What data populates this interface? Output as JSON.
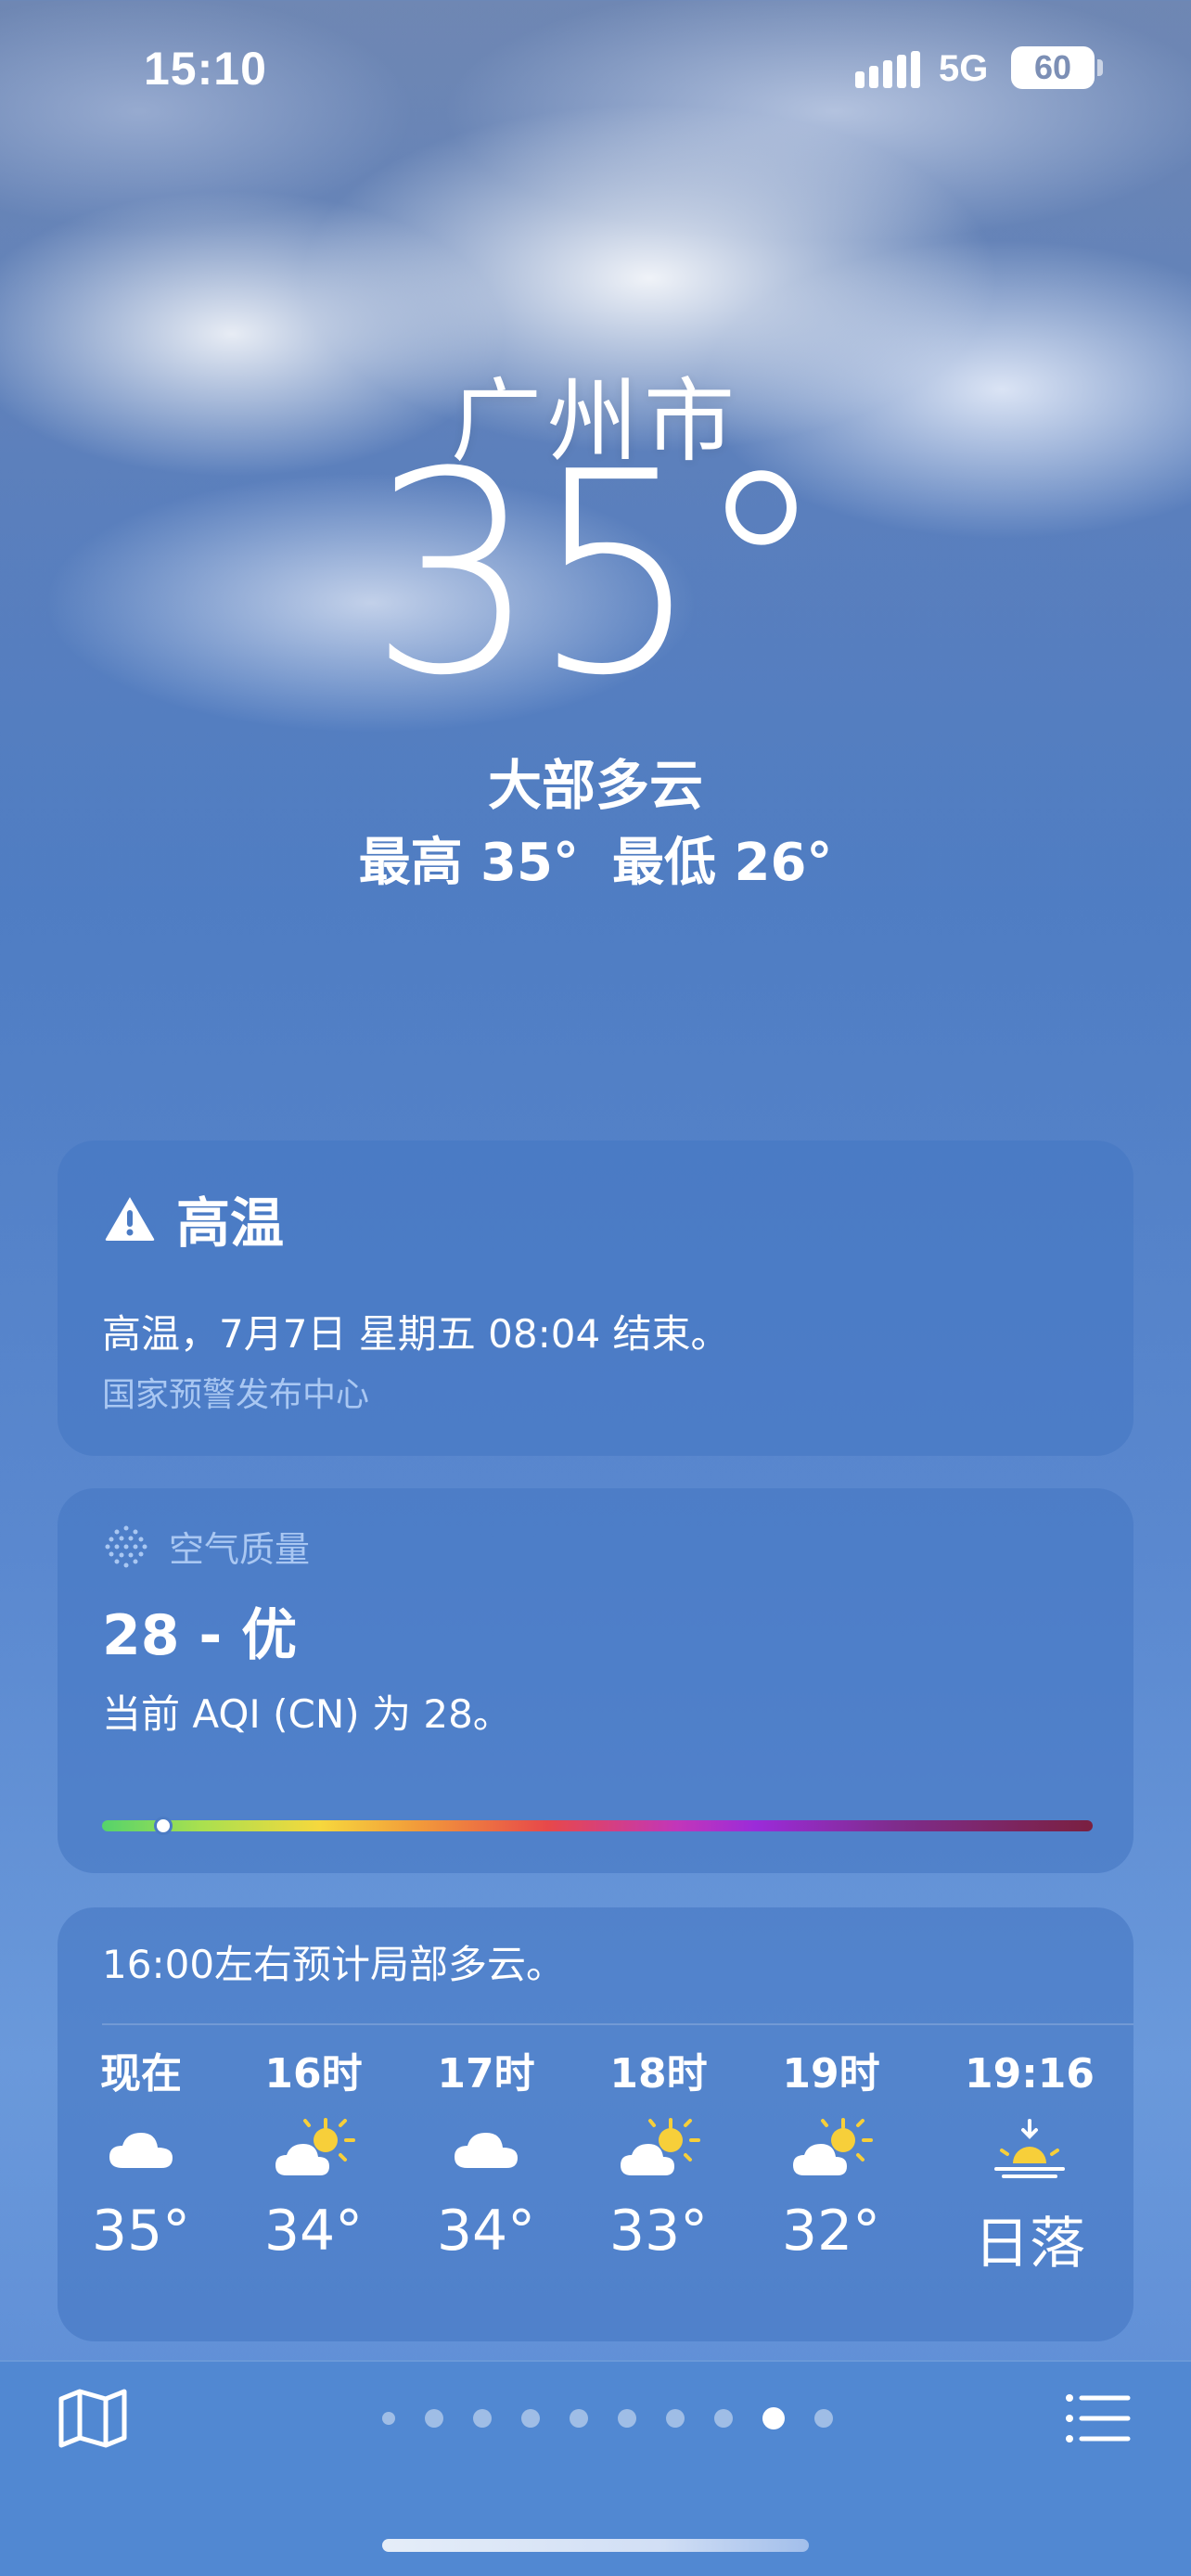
{
  "status_bar": {
    "time": "15:10",
    "network": "5G",
    "battery": "60"
  },
  "location": {
    "city": "广州市",
    "temperature": "35°",
    "condition": "大部多云",
    "high": "最高 35°",
    "low": "最低 26°"
  },
  "alert": {
    "icon": "warning-icon",
    "title": "高温",
    "description": "高温，7月7日 星期五 08:04 结束。",
    "source": "国家预警发布中心"
  },
  "air_quality": {
    "icon": "aqi-dots-icon",
    "header": "空气质量",
    "value": "28 - 优",
    "description": "当前 AQI (CN) 为 28。",
    "aqi_numeric": 28
  },
  "hourly": {
    "summary": "16:00左右预计局部多云。",
    "items": [
      {
        "time": "现在",
        "icon": "cloud-icon",
        "temp": "35°"
      },
      {
        "time": "16时",
        "icon": "partly-cloudy-icon",
        "temp": "34°"
      },
      {
        "time": "17时",
        "icon": "cloud-icon",
        "temp": "34°"
      },
      {
        "time": "18时",
        "icon": "partly-cloudy-icon",
        "temp": "33°"
      },
      {
        "time": "19时",
        "icon": "partly-cloudy-icon",
        "temp": "32°"
      },
      {
        "time": "19:16",
        "icon": "sunset-icon",
        "temp": "日落"
      }
    ]
  },
  "bottom_bar": {
    "map_icon": "map-icon",
    "list_icon": "list-icon",
    "page_count": 10,
    "active_page_index": 8
  },
  "colors": {
    "accent_label": "#a9c7f2",
    "sun": "#f7cf3a"
  }
}
